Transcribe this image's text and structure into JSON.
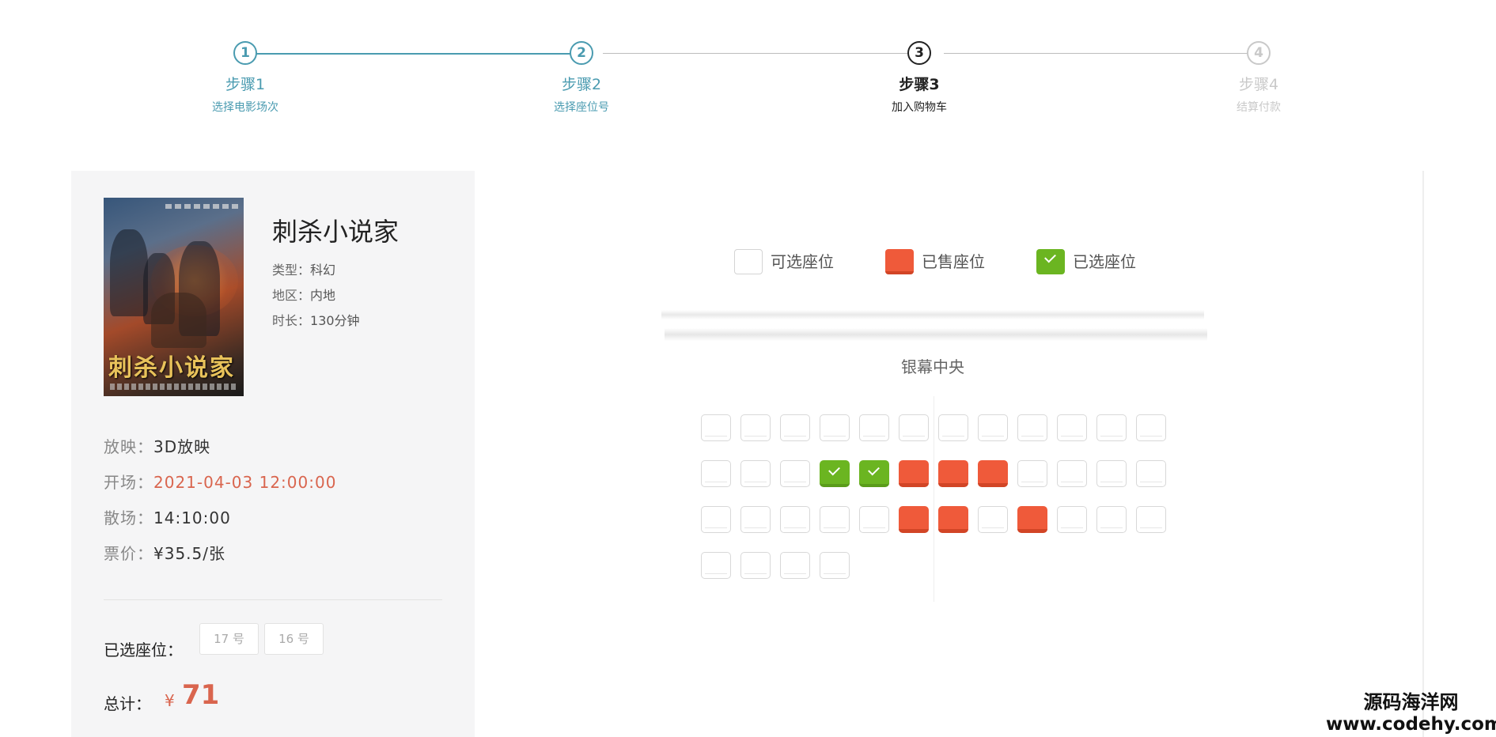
{
  "steps": [
    {
      "title": "步骤1",
      "subtitle": "选择电影场次",
      "number": "1",
      "state": "done"
    },
    {
      "title": "步骤2",
      "subtitle": "选择座位号",
      "number": "2",
      "state": "done"
    },
    {
      "title": "步骤3",
      "subtitle": "加入购物车",
      "number": "3",
      "state": "active"
    },
    {
      "title": "步骤4",
      "subtitle": "结算付款",
      "number": "4",
      "state": "pending"
    }
  ],
  "movie": {
    "title": "刺杀小说家",
    "poster_title": "刺杀小说家",
    "type_label": "类型：",
    "type_value": "科幻",
    "region_label": "地区：",
    "region_value": "内地",
    "duration_label": "时长：",
    "duration_value": "130分钟"
  },
  "showing": {
    "format_label": "放映：",
    "format_value": "3D放映",
    "start_label": "开场：",
    "start_value": "2021-04-03 12:00:00",
    "end_label": "散场：",
    "end_value": "14:10:00",
    "price_label": "票价：",
    "price_value": "¥35.5/张"
  },
  "selection": {
    "label": "已选座位：",
    "seats": [
      "17 号",
      "16 号"
    ]
  },
  "total": {
    "label": "总计：",
    "currency": "¥",
    "value": "71"
  },
  "legend": {
    "available": "可选座位",
    "sold": "已售座位",
    "selected": "已选座位"
  },
  "screen_label": "银幕中央",
  "seat_rows": [
    [
      "empty",
      "empty",
      "empty",
      "empty",
      "empty",
      "empty",
      "empty",
      "empty",
      "empty",
      "empty",
      "empty",
      "empty"
    ],
    [
      "empty",
      "empty",
      "empty",
      "selected",
      "selected",
      "sold",
      "sold",
      "sold",
      "empty",
      "empty",
      "empty",
      "empty"
    ],
    [
      "empty",
      "empty",
      "empty",
      "empty",
      "empty",
      "sold",
      "sold",
      "empty",
      "sold",
      "empty",
      "empty",
      "empty"
    ],
    [
      "empty",
      "empty",
      "empty",
      "empty"
    ]
  ],
  "colors": {
    "accent": "#4a9bb0",
    "sold": "#ef5a3a",
    "selected": "#6bb521",
    "price_red": "#d9654e"
  },
  "watermark": {
    "line1": "源码海洋网",
    "line2": "www.codehy.com"
  }
}
